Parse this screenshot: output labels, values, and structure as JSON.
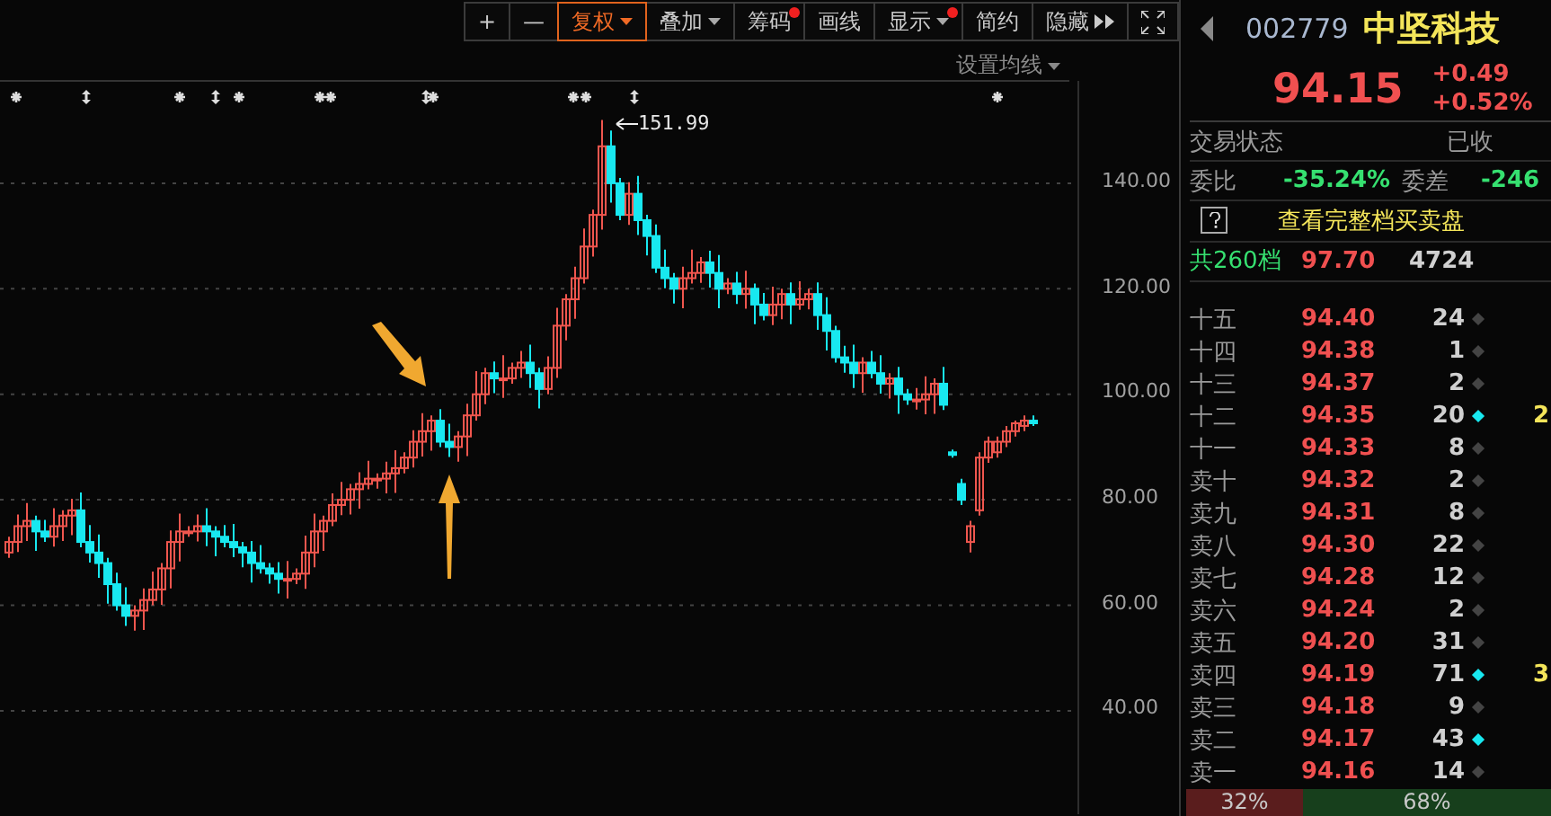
{
  "toolbar": [
    {
      "label": "+",
      "selected": false,
      "dropdown": false,
      "badge": false
    },
    {
      "label": "—",
      "selected": false,
      "dropdown": false,
      "badge": false
    },
    {
      "label": "复权",
      "selected": true,
      "dropdown": true,
      "badge": false
    },
    {
      "label": "叠加",
      "selected": false,
      "dropdown": true,
      "badge": false
    },
    {
      "label": "筹码",
      "selected": false,
      "dropdown": false,
      "badge": true
    },
    {
      "label": "画线",
      "selected": false,
      "dropdown": false,
      "badge": false
    },
    {
      "label": "显示",
      "selected": false,
      "dropdown": true,
      "badge": true
    },
    {
      "label": "简约",
      "selected": false,
      "dropdown": false,
      "badge": false
    },
    {
      "label": "隐藏",
      "selected": false,
      "dropdown": false,
      "badge": false,
      "expand": true
    }
  ],
  "chart": {
    "ma_settings": "设置均线",
    "peak_label": "151.99",
    "chart_data": {
      "type": "candlestick",
      "ylim": [
        20.4,
        159.4
      ],
      "grid": true,
      "yticks": [
        {
          "value": 140,
          "label": "140.00"
        },
        {
          "value": 120,
          "label": "120.00"
        },
        {
          "value": 100,
          "label": "100.00"
        },
        {
          "value": 80,
          "label": "80.00"
        },
        {
          "value": 60,
          "label": "60.00"
        },
        {
          "value": 40,
          "label": "40.00"
        }
      ],
      "categories": [
        null,
        null,
        null,
        null,
        null,
        null,
        null,
        null,
        null,
        null,
        null,
        null,
        null,
        null,
        null,
        null,
        null,
        null,
        null,
        null,
        null,
        null,
        null,
        null,
        null,
        null,
        null,
        null,
        null,
        null,
        null,
        null,
        null,
        null,
        null,
        null,
        null,
        null,
        null,
        null,
        null,
        null,
        null,
        null,
        null,
        null,
        null,
        null,
        null,
        null,
        null,
        null,
        null,
        null,
        null,
        null,
        null,
        null,
        null,
        null,
        null,
        null,
        null,
        null,
        null,
        null,
        null,
        null,
        null,
        null,
        null,
        null,
        null,
        null,
        null,
        null,
        null,
        null,
        null,
        null,
        null,
        null,
        null,
        null,
        null,
        null,
        null,
        null,
        null,
        null,
        null,
        null,
        null,
        null,
        null,
        null,
        null,
        null,
        null,
        null,
        null,
        null,
        null,
        null,
        null,
        null,
        null,
        null,
        null,
        null,
        null,
        null,
        null,
        null,
        null
      ],
      "ohlc": [
        [
          70,
          73,
          69,
          72
        ],
        [
          72,
          77.2,
          70.1,
          75
        ],
        [
          75,
          79.4,
          72.2,
          76
        ],
        [
          76,
          77,
          70.3,
          74
        ],
        [
          74,
          76.2,
          72,
          73
        ],
        [
          73,
          78.4,
          71.1,
          75
        ],
        [
          75,
          78,
          72.2,
          77
        ],
        [
          77,
          80.2,
          73.3,
          78
        ],
        [
          78,
          81.4,
          71,
          72
        ],
        [
          72,
          75.2,
          68.1,
          70
        ],
        [
          70,
          73.4,
          65.2,
          68
        ],
        [
          68,
          69,
          60.3,
          64
        ],
        [
          64,
          66.2,
          59,
          60
        ],
        [
          60,
          63.4,
          56.1,
          58
        ],
        [
          58,
          60,
          55.2,
          59
        ],
        [
          59,
          63.2,
          55.3,
          61
        ],
        [
          61,
          66.4,
          60,
          63
        ],
        [
          63,
          68,
          60.1,
          67
        ],
        [
          67,
          74.2,
          63.2,
          72
        ],
        [
          72,
          77.4,
          68.3,
          74
        ],
        [
          74,
          75,
          73,
          74
        ],
        [
          74,
          77.2,
          72.1,
          75
        ],
        [
          75,
          78.4,
          71.2,
          74
        ],
        [
          74,
          75,
          69.3,
          73
        ],
        [
          73,
          75.2,
          71,
          72
        ],
        [
          72,
          75.4,
          69.1,
          71
        ],
        [
          71,
          72,
          67.2,
          70
        ],
        [
          70,
          72.2,
          64.3,
          68
        ],
        [
          68,
          71.4,
          66,
          67
        ],
        [
          67,
          68,
          64.1,
          66
        ],
        [
          66,
          68.2,
          62.2,
          65
        ],
        [
          65,
          68.4,
          61.3,
          65
        ],
        [
          65,
          67,
          64,
          66
        ],
        [
          66,
          73.2,
          63.1,
          70
        ],
        [
          70,
          77.4,
          67.2,
          74
        ],
        [
          74,
          77,
          70.3,
          76
        ],
        [
          76,
          81.2,
          75,
          79
        ],
        [
          79,
          83.4,
          77.1,
          80
        ],
        [
          80,
          83,
          77.2,
          82
        ],
        [
          82,
          85.2,
          78.3,
          83
        ],
        [
          83,
          87.4,
          82,
          84
        ],
        [
          84,
          85,
          82.1,
          84
        ],
        [
          84,
          87.2,
          81.2,
          85
        ],
        [
          85,
          89.4,
          81.3,
          86
        ],
        [
          86,
          89,
          85,
          88
        ],
        [
          88,
          93.2,
          86.1,
          91
        ],
        [
          91,
          96.4,
          88.2,
          93
        ],
        [
          93,
          96,
          89.3,
          95
        ],
        [
          95,
          97.2,
          90,
          91
        ],
        [
          91,
          94.4,
          88.1,
          90
        ],
        [
          90,
          93,
          87.2,
          92
        ],
        [
          92,
          98.2,
          88.3,
          96
        ],
        [
          96,
          104.4,
          95,
          100
        ],
        [
          100,
          105,
          98.1,
          104
        ],
        [
          104,
          106.2,
          100.2,
          103
        ],
        [
          103,
          107.4,
          99.3,
          103
        ],
        [
          103,
          106,
          102,
          105
        ],
        [
          105,
          108.2,
          103.1,
          106
        ],
        [
          106,
          109.4,
          101.2,
          104
        ],
        [
          104,
          105,
          97.3,
          101
        ],
        [
          101,
          107.2,
          100,
          105
        ],
        [
          105,
          116.4,
          103.1,
          113
        ],
        [
          113,
          119,
          110.2,
          118
        ],
        [
          118,
          124.2,
          114.3,
          122
        ],
        [
          122,
          131.4,
          121,
          128
        ],
        [
          128,
          135,
          126.1,
          134
        ],
        [
          134,
          151.99,
          131.2,
          147
        ],
        [
          147,
          150,
          136.3,
          140
        ],
        [
          140,
          141,
          133,
          134
        ],
        [
          134,
          140.2,
          132.1,
          138
        ],
        [
          138,
          141.4,
          130.2,
          133
        ],
        [
          133,
          134,
          126.3,
          130
        ],
        [
          130,
          132.2,
          123,
          124
        ],
        [
          124,
          127.4,
          120.1,
          122
        ],
        [
          122,
          123,
          117.2,
          120
        ],
        [
          120,
          124.2,
          116.3,
          122
        ],
        [
          122,
          127.4,
          121,
          123
        ],
        [
          123,
          126,
          121.1,
          125
        ],
        [
          125,
          127.2,
          120.2,
          123
        ],
        [
          123,
          126.4,
          116.3,
          120
        ],
        [
          120,
          122,
          119,
          121
        ],
        [
          121,
          123.2,
          117.1,
          119
        ],
        [
          119,
          123.4,
          116.2,
          120
        ],
        [
          120,
          121,
          113.3,
          117
        ],
        [
          117,
          119.2,
          114,
          115
        ],
        [
          115,
          120.4,
          113.1,
          117
        ],
        [
          117,
          120,
          114.2,
          119
        ],
        [
          119,
          121.2,
          113.3,
          117
        ],
        [
          117,
          121.4,
          116,
          118
        ],
        [
          118,
          120,
          116.1,
          119
        ],
        [
          119,
          121.2,
          112.2,
          115
        ],
        [
          115,
          118.4,
          108.3,
          112
        ],
        [
          112,
          113,
          106,
          107
        ],
        [
          107,
          109.2,
          104.1,
          106
        ],
        [
          106,
          109.4,
          101.2,
          104
        ],
        [
          104,
          107,
          100.3,
          106
        ],
        [
          106,
          108.2,
          103,
          104
        ],
        [
          104,
          107.4,
          100.1,
          102
        ],
        [
          102,
          104,
          99.2,
          103
        ],
        [
          103,
          105.2,
          96.3,
          100
        ],
        [
          100,
          101,
          98,
          99
        ],
        [
          99,
          101.2,
          97.1,
          99
        ],
        [
          99,
          103.4,
          96.2,
          100
        ],
        [
          100,
          103,
          96.3,
          102
        ],
        [
          102,
          105.2,
          97,
          98
        ],
        [
          89,
          89.5,
          88,
          88.5
        ],
        [
          83,
          84,
          79,
          80
        ],
        [
          72,
          76,
          70,
          75
        ],
        [
          78,
          89,
          77,
          88
        ],
        [
          88,
          92,
          87,
          91
        ],
        [
          89,
          92,
          88,
          91
        ],
        [
          91,
          94,
          90,
          93
        ],
        [
          93,
          95,
          92,
          94.5
        ],
        [
          94,
          96,
          93,
          95
        ],
        [
          95,
          96,
          94,
          94.5
        ]
      ]
    }
  },
  "quote": {
    "code": "002779",
    "name": "中坚科技",
    "price": "94.15",
    "change": "+0.49",
    "change_pct": "+0.52%",
    "status_label": "交易状态",
    "status_value": "已收",
    "ratio_label": "委比",
    "ratio_value": "-35.24%",
    "diff_label": "委差",
    "diff_value": "-246",
    "full_book_link": "查看完整档买卖盘",
    "levels_count": "共260档",
    "levels_price": "97.70",
    "levels_volume": "4724"
  },
  "asks": [
    {
      "label": "十五",
      "price": "94.40",
      "volume": "24",
      "highlighted": false
    },
    {
      "label": "十四",
      "price": "94.38",
      "volume": "1",
      "highlighted": false
    },
    {
      "label": "十三",
      "price": "94.37",
      "volume": "2",
      "highlighted": false
    },
    {
      "label": "十二",
      "price": "94.35",
      "volume": "20",
      "highlighted": true,
      "note": "2"
    },
    {
      "label": "十一",
      "price": "94.33",
      "volume": "8",
      "highlighted": false
    },
    {
      "label": "卖十",
      "price": "94.32",
      "volume": "2",
      "highlighted": false
    },
    {
      "label": "卖九",
      "price": "94.31",
      "volume": "8",
      "highlighted": false
    },
    {
      "label": "卖八",
      "price": "94.30",
      "volume": "22",
      "highlighted": false
    },
    {
      "label": "卖七",
      "price": "94.28",
      "volume": "12",
      "highlighted": false
    },
    {
      "label": "卖六",
      "price": "94.24",
      "volume": "2",
      "highlighted": false
    },
    {
      "label": "卖五",
      "price": "94.20",
      "volume": "31",
      "highlighted": false
    },
    {
      "label": "卖四",
      "price": "94.19",
      "volume": "71",
      "highlighted": true,
      "note": "3"
    },
    {
      "label": "卖三",
      "price": "94.18",
      "volume": "9",
      "highlighted": false
    },
    {
      "label": "卖二",
      "price": "94.17",
      "volume": "43",
      "highlighted": true
    },
    {
      "label": "卖一",
      "price": "94.16",
      "volume": "14",
      "highlighted": false
    }
  ],
  "balance": {
    "buy_pct": "32%",
    "sell_pct": "68%"
  }
}
